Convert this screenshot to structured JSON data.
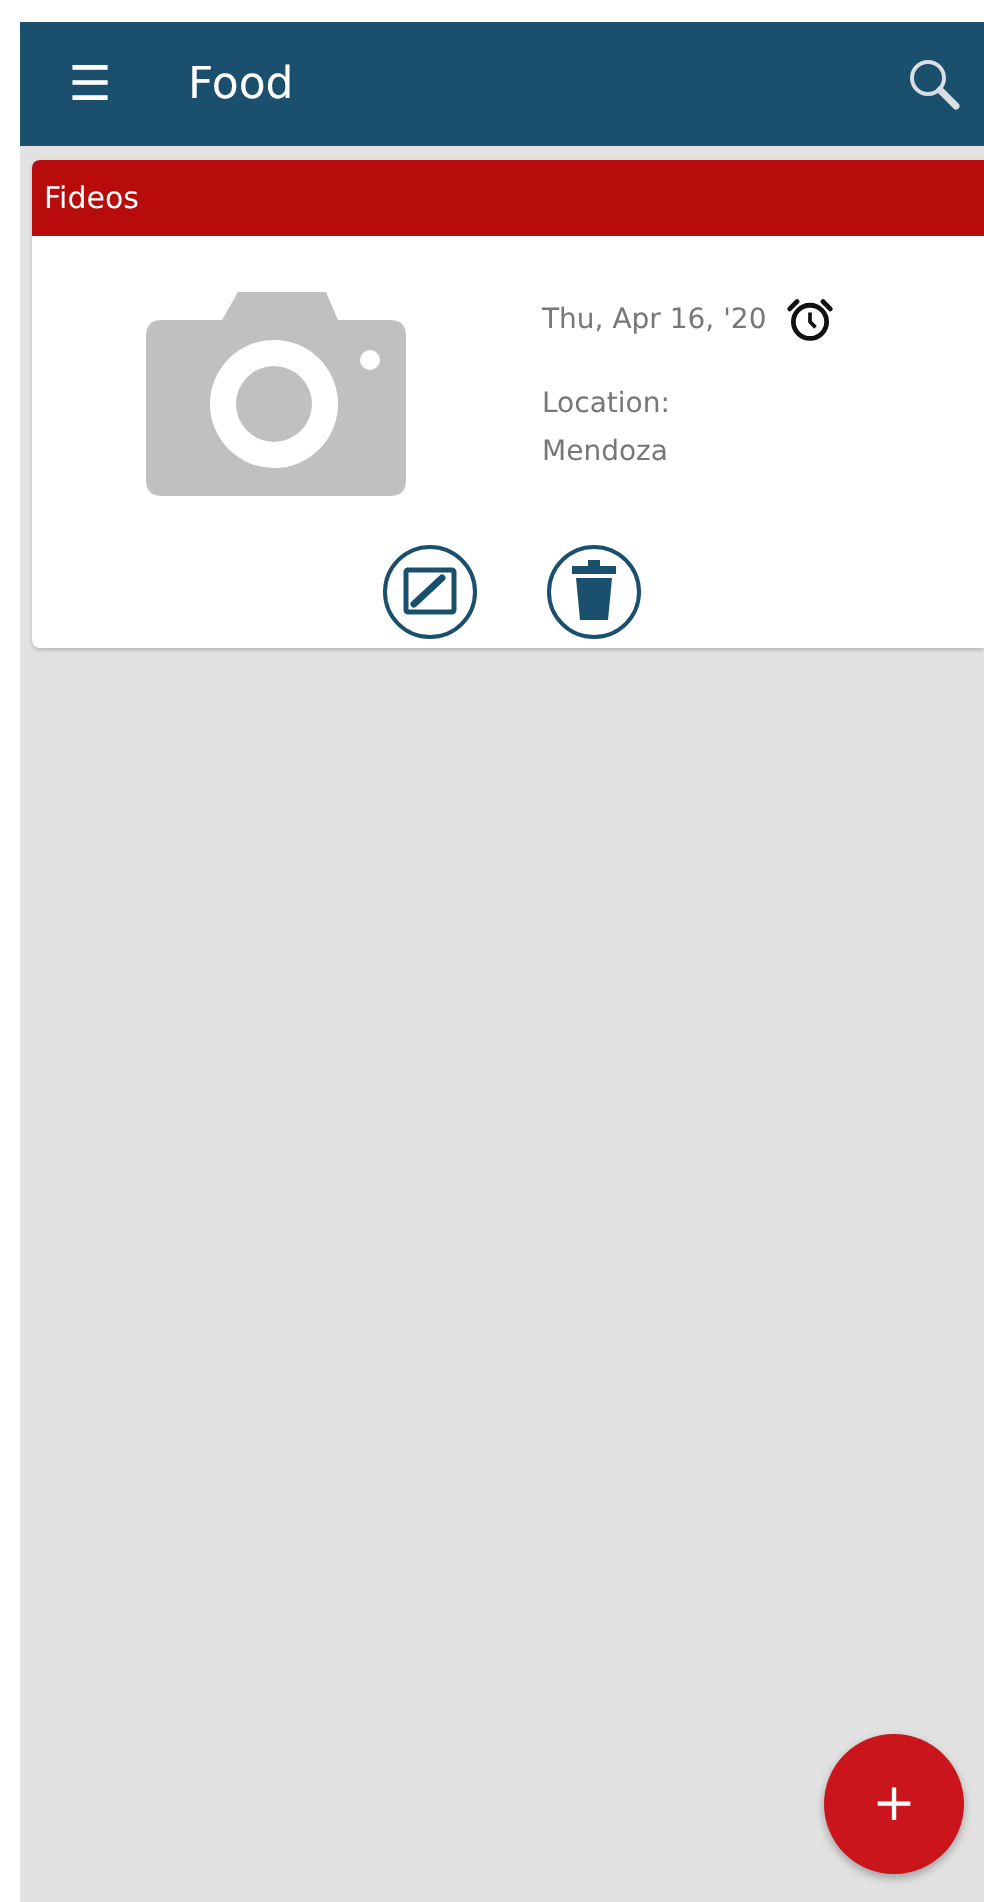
{
  "app_bar": {
    "menu_icon": "☰",
    "title": "Food"
  },
  "items": [
    {
      "title": "Fideos",
      "date": "Thu, Apr 16, '20",
      "location_label": "Location:",
      "location": "Mendoza"
    }
  ],
  "fab": {
    "label": "+"
  }
}
